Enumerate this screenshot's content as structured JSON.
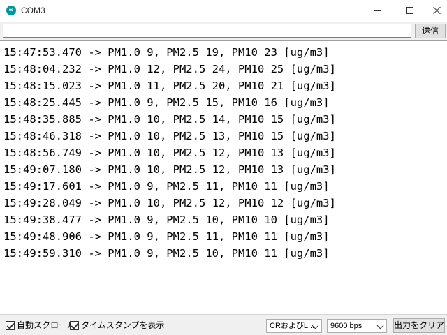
{
  "window": {
    "title": "COM3"
  },
  "send": {
    "input_value": "",
    "button_label": "送信"
  },
  "output": {
    "lines": [
      "15:47:53.470 -> PM1.0 9, PM2.5 19, PM10 23 [ug/m3]",
      "15:48:04.232 -> PM1.0 12, PM2.5 24, PM10 25 [ug/m3]",
      "15:48:15.023 -> PM1.0 11, PM2.5 20, PM10 21 [ug/m3]",
      "15:48:25.445 -> PM1.0 9, PM2.5 15, PM10 16 [ug/m3]",
      "15:48:35.885 -> PM1.0 10, PM2.5 14, PM10 15 [ug/m3]",
      "15:48:46.318 -> PM1.0 10, PM2.5 13, PM10 15 [ug/m3]",
      "15:48:56.749 -> PM1.0 10, PM2.5 12, PM10 13 [ug/m3]",
      "15:49:07.180 -> PM1.0 10, PM2.5 12, PM10 13 [ug/m3]",
      "15:49:17.601 -> PM1.0 9, PM2.5 11, PM10 11 [ug/m3]",
      "15:49:28.049 -> PM1.0 10, PM2.5 12, PM10 12 [ug/m3]",
      "15:49:38.477 -> PM1.0 9, PM2.5 10, PM10 10 [ug/m3]",
      "15:49:48.906 -> PM1.0 9, PM2.5 11, PM10 11 [ug/m3]",
      "15:49:59.310 -> PM1.0 9, PM2.5 10, PM10 11 [ug/m3]"
    ]
  },
  "bottom": {
    "autoscroll_label": "自動スクロール",
    "autoscroll_checked": true,
    "timestamp_label": "タイムスタンプを表示",
    "timestamp_checked": true,
    "line_ending_value": "CRおよびL...",
    "baud_value": "9600 bps",
    "clear_label": "出力をクリア"
  },
  "icons": {
    "app": "arduino-icon",
    "minimize": "minimize-icon",
    "maximize": "maximize-icon",
    "close": "close-icon",
    "dropdown": "chevron-down-icon",
    "checkbox": "checkmark-icon"
  },
  "colors": {
    "app_icon": "#00979c",
    "panel_bg": "#f0f0f0",
    "output_bg": "#ffffff"
  }
}
